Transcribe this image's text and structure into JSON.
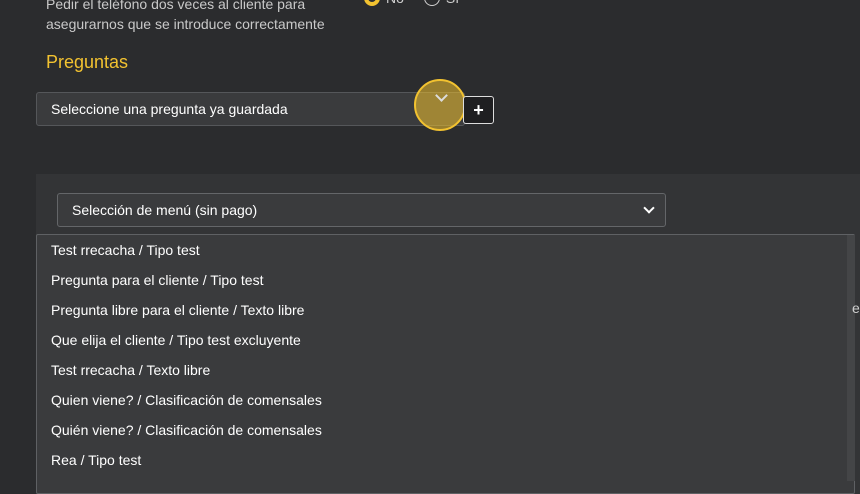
{
  "phone_option": {
    "text": "Pedir el teléfono dos veces al cliente para asegurarnos que se introduce correctamente",
    "no_label": "No",
    "si_label": "Sí"
  },
  "questions": {
    "title": "Preguntas",
    "select_placeholder": "Seleccione una pregunta ya guardada",
    "add_label": "+"
  },
  "menu_select": {
    "value": "Selección de menú (sin pago)"
  },
  "options": [
    "Test rrecacha / Tipo test",
    "Pregunta para el cliente / Tipo test",
    "Pregunta libre para el cliente / Texto libre",
    "Que elija el cliente / Tipo test excluyente",
    "Test rrecacha / Texto libre",
    "Quien viene? / Clasificación de comensales",
    "Quién viene? / Clasificación de comensales",
    "Rea / Tipo test"
  ],
  "edge_text": "e",
  "colors": {
    "accent": "#f2c230",
    "background": "#2b2c2e"
  }
}
